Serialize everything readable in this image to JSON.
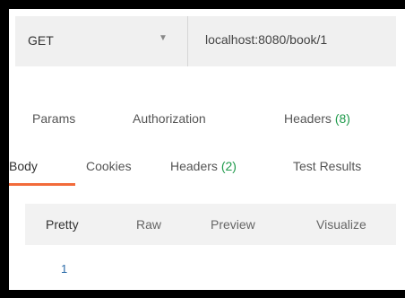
{
  "request": {
    "method": "GET",
    "url": "localhost:8080/book/1"
  },
  "request_tabs": [
    {
      "label": "Params"
    },
    {
      "label": "Authorization"
    },
    {
      "label": "Headers",
      "count": "(8)"
    }
  ],
  "response_tabs": [
    {
      "label": "Body"
    },
    {
      "label": "Cookies"
    },
    {
      "label": "Headers",
      "count": "(2)"
    },
    {
      "label": "Test Results"
    }
  ],
  "view_tabs": [
    {
      "label": "Pretty"
    },
    {
      "label": "Raw"
    },
    {
      "label": "Preview"
    },
    {
      "label": "Visualize"
    }
  ],
  "body": {
    "line_number": "1"
  },
  "colors": {
    "accent": "#f26b3a",
    "count_green": "#1f9a4b",
    "line_number": "#2a6aa8"
  },
  "icons": {
    "method_dropdown": "chevron-down-icon"
  }
}
